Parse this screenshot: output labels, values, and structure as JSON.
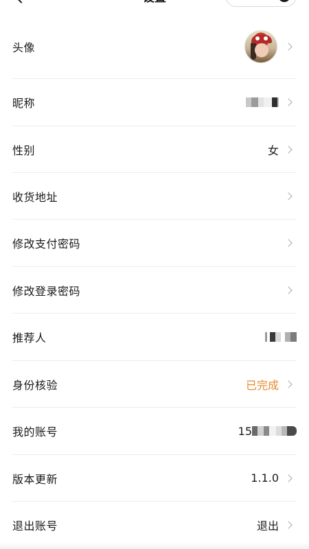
{
  "navbar": {
    "title": "设置"
  },
  "rows": [
    {
      "label": "头像",
      "value": ""
    },
    {
      "label": "昵称",
      "value": ""
    },
    {
      "label": "性别",
      "value": "女"
    },
    {
      "label": "收货地址",
      "value": ""
    },
    {
      "label": "修改支付密码",
      "value": ""
    },
    {
      "label": "修改登录密码",
      "value": ""
    },
    {
      "label": "推荐人",
      "value": ""
    },
    {
      "label": "身份核验",
      "value": "已完成"
    },
    {
      "label": "我的账号",
      "value": "15"
    },
    {
      "label": "版本更新",
      "value": "1.1.0"
    },
    {
      "label": "退出账号",
      "value": "退出"
    }
  ],
  "colors": {
    "status_accent": "#e8892b",
    "divider": "#ececec",
    "chevron": "#a8a8a8"
  },
  "icons": {
    "back": "chevron-left-icon",
    "row_arrow": "chevron-right-icon",
    "capsule_close": "target-circle-icon"
  }
}
